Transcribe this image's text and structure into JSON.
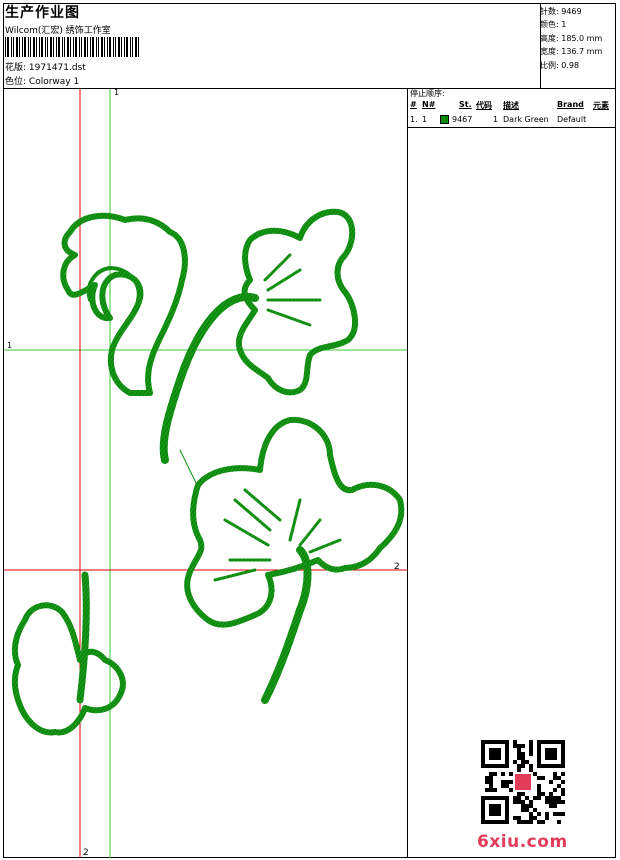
{
  "header": {
    "title": "生产作业图",
    "company": "Wilcom(汇宏) 绣饰工作室",
    "pattern_label": "花版:",
    "pattern_value": "1971471.dst",
    "colorway_label": "色位:",
    "colorway_value": "Colorway 1"
  },
  "stats": {
    "stitches": "针数: 9469",
    "colors": "颜色: 1",
    "height": "高度: 185.0 mm",
    "width": "宽度: 136.7 mm",
    "scale": "比例: 0.98"
  },
  "stop_sequence": {
    "title": "停止顺序:",
    "headers": [
      "#",
      "N#",
      "St.",
      "代码",
      "描述",
      "Brand",
      "元素"
    ],
    "rows": [
      {
        "index": "1.",
        "needle": "1",
        "stitches": "9467",
        "code": "1",
        "description": "Dark Green",
        "brand": "Default",
        "color": "#0a8a0a"
      }
    ]
  },
  "guides": {
    "green_v_label": "1",
    "green_h_label": "1",
    "red_h_label": "2",
    "red_v_label": "2"
  },
  "colors": {
    "stitch": "#0a8a0a",
    "red_guide": "#e00000",
    "green_guide": "#33cc33",
    "watermark": "#e33b5a"
  },
  "watermark": {
    "text": "6xiu.com"
  }
}
